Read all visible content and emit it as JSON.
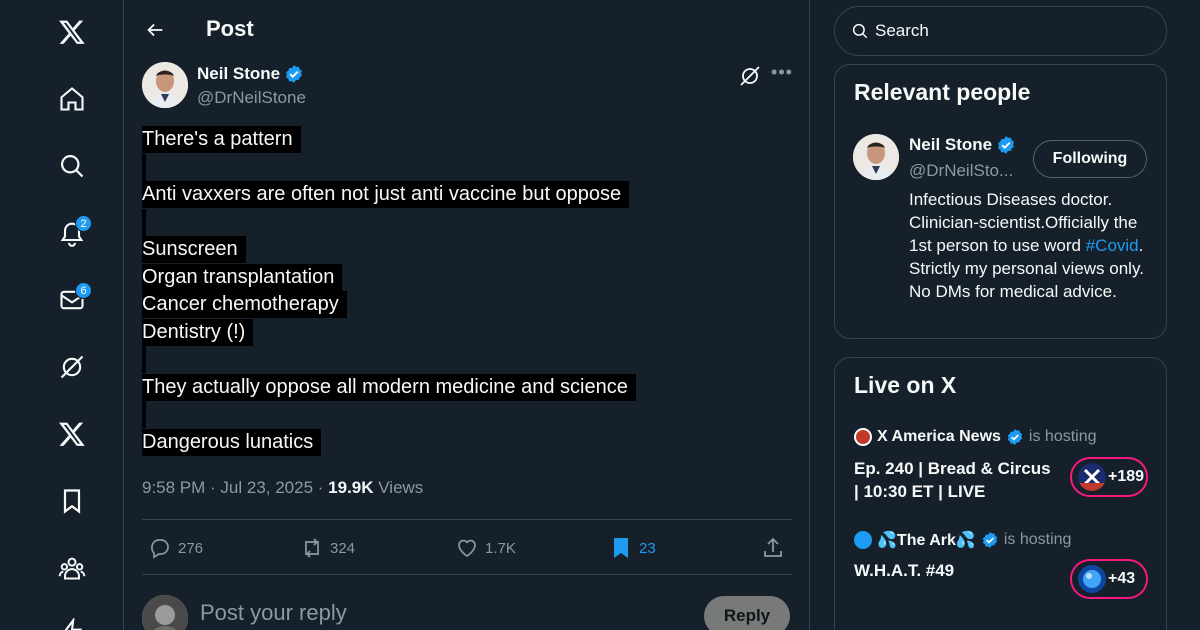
{
  "header": {
    "title": "Post"
  },
  "nav": {
    "notifications_count": "2",
    "messages_count": "6"
  },
  "tweet": {
    "author_name": "Neil Stone",
    "author_handle": "@DrNeilStone",
    "lines": [
      "There's a pattern",
      "",
      "Anti vaxxers are often not just anti vaccine but oppose",
      "",
      "Sunscreen",
      "Organ transplantation",
      "Cancer chemotherapy",
      "Dentistry (!)",
      "",
      "They actually oppose all modern medicine and science",
      "",
      "Dangerous lunatics"
    ],
    "time": "9:58 PM · Jul 23, 2025 · ",
    "views_count": "19.9K",
    "views_label": " Views",
    "replies": "276",
    "reposts": "324",
    "likes": "1.7K",
    "bookmarks": "23"
  },
  "reply": {
    "placeholder": "Post your reply",
    "button_label": "Reply"
  },
  "search": {
    "placeholder": "Search"
  },
  "relevant_people": {
    "title": "Relevant people",
    "name": "Neil Stone",
    "handle": "@DrNeilSto...",
    "follow_label": "Following",
    "bio_before": "Infectious Diseases doctor. Clinician-scientist.Officially the 1st person to use word ",
    "bio_tag": "#Covid",
    "bio_after": ". Strictly my personal views only. No DMs for medical advice."
  },
  "live": {
    "title": "Live on X",
    "items": [
      {
        "host": "X America News",
        "hosting": "is hosting",
        "title": "Ep. 240 | Bread & Circus | 10:30 ET | LIVE",
        "count": "+189"
      },
      {
        "host": "💦The Ark💦",
        "hosting": "is hosting",
        "title": "W.H.A.T. #49",
        "count": "+43"
      }
    ]
  },
  "colors": {
    "accent": "#1d9bf0",
    "background": "#15202b",
    "live_ring": "#f91880"
  }
}
